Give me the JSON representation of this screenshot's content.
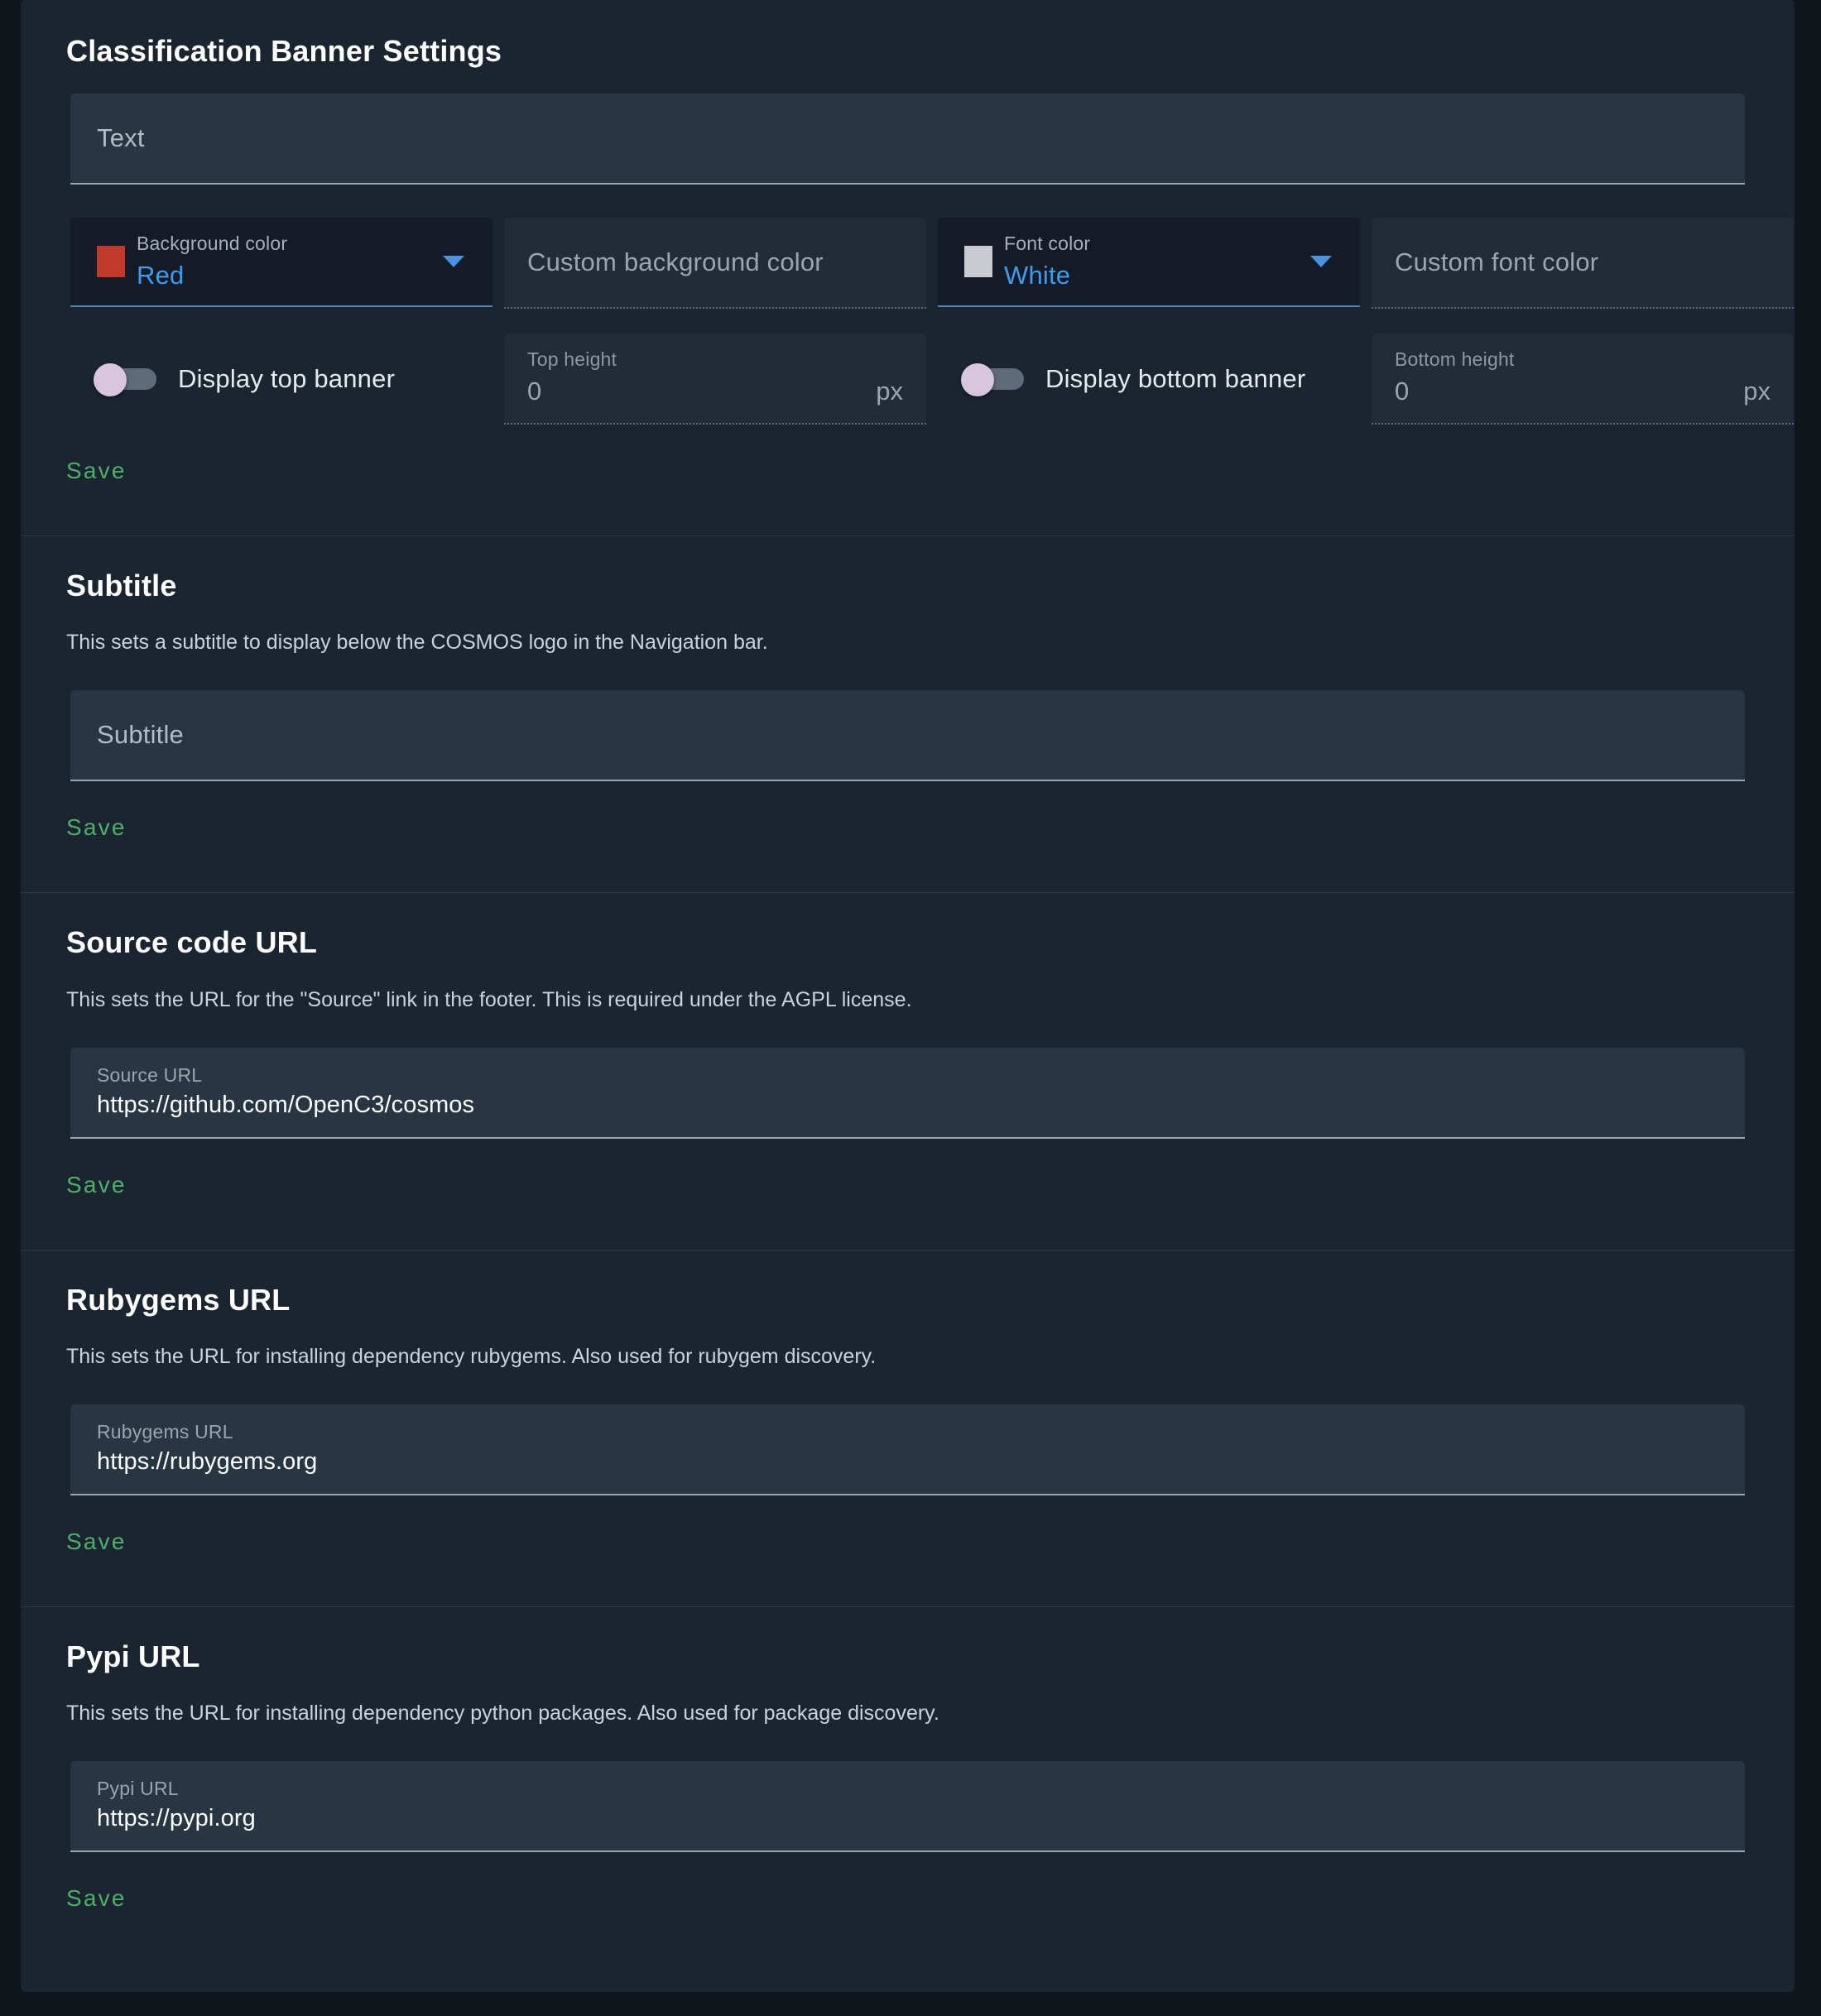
{
  "sections": {
    "banner": {
      "title": "Classification Banner Settings",
      "text_field": {
        "placeholder": "Text",
        "value": ""
      },
      "background_color": {
        "label": "Background color",
        "value": "Red",
        "swatch_hex": "#c0392b",
        "chevron_icon": "chevron-down-icon"
      },
      "custom_background_color": {
        "placeholder": "Custom background color",
        "value": ""
      },
      "font_color": {
        "label": "Font color",
        "value": "White",
        "swatch_hex": "#c8ccd0",
        "chevron_icon": "chevron-down-icon"
      },
      "custom_font_color": {
        "placeholder": "Custom font color",
        "value": ""
      },
      "display_top_banner": {
        "label": "Display top banner",
        "state": "off"
      },
      "top_height": {
        "label": "Top height",
        "value": "0",
        "suffix": "px"
      },
      "display_bottom_banner": {
        "label": "Display bottom banner",
        "state": "off"
      },
      "bottom_height": {
        "label": "Bottom height",
        "value": "0",
        "suffix": "px"
      },
      "save_label": "Save"
    },
    "subtitle": {
      "title": "Subtitle",
      "description": "This sets a subtitle to display below the COSMOS logo in the Navigation bar.",
      "field": {
        "placeholder": "Subtitle",
        "value": ""
      },
      "save_label": "Save"
    },
    "source_code_url": {
      "title": "Source code URL",
      "description": "This sets the URL for the \"Source\" link in the footer. This is required under the AGPL license.",
      "field": {
        "label": "Source URL",
        "value": "https://github.com/OpenC3/cosmos"
      },
      "save_label": "Save"
    },
    "rubygems_url": {
      "title": "Rubygems URL",
      "description": "This sets the URL for installing dependency rubygems. Also used for rubygem discovery.",
      "field": {
        "label": "Rubygems URL",
        "value": "https://rubygems.org"
      },
      "save_label": "Save"
    },
    "pypi_url": {
      "title": "Pypi URL",
      "description": "This sets the URL for installing dependency python packages. Also used for package discovery.",
      "field": {
        "label": "Pypi URL",
        "value": "https://pypi.org"
      },
      "save_label": "Save"
    }
  },
  "theme": {
    "page_background": "#10151c",
    "card_background": "#1b2530",
    "field_background": "#273642",
    "accent_blue": "#3d9bf0",
    "accent_green": "#4caf6a",
    "toggle_thumb": "#d8c6e0"
  }
}
